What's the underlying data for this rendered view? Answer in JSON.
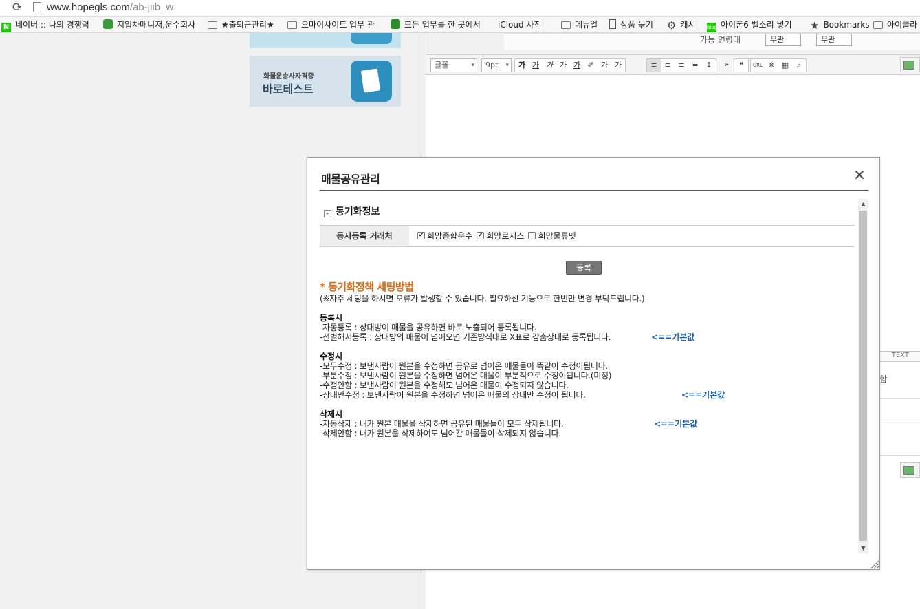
{
  "browser": {
    "url_host": "www.hopegls.com",
    "url_path": "/ab-jiib_w",
    "bookmarks": [
      {
        "icon": "naver-icon",
        "label": "네이버 :: 나의 경쟁력"
      },
      {
        "icon": "truck-icon",
        "label": "지입차매니저,운수회사"
      },
      {
        "icon": "folder-icon",
        "label": "★출퇴근관리★"
      },
      {
        "icon": "folder-icon",
        "label": "오마이사이트 업무 관"
      },
      {
        "icon": "evernote-icon",
        "label": "모든 업무를 한 곳에서"
      },
      {
        "icon": "apple-icon",
        "label": "iCloud 사진"
      },
      {
        "icon": "folder-icon",
        "label": "메뉴얼"
      },
      {
        "icon": "document-icon",
        "label": "상품 묶기"
      },
      {
        "icon": "gear-icon",
        "label": "캐시"
      },
      {
        "icon": "blog-icon",
        "label": "아이폰6 벨소리 넣기"
      },
      {
        "icon": "star-icon",
        "label": "Bookmarks"
      },
      {
        "icon": "folder-icon",
        "label": "아이클라"
      }
    ]
  },
  "background": {
    "banner_small": "화물운송사자격증",
    "banner_big": "바로테스트",
    "top_label": "가능 연령대",
    "top_select1": "무관",
    "top_select2": "무관",
    "font_select": "글꼴",
    "size_select": "9pt",
    "toolbar_buttons": [
      "가",
      "가",
      "가",
      "가",
      "가",
      "✐",
      "가",
      "가"
    ],
    "text_tab": "TEXT",
    "side_text": "함"
  },
  "modal": {
    "title": "매물공유관리",
    "section_title": "동기화정보",
    "row_label": "동시등록 거래처",
    "checkboxes": [
      {
        "label": "희망종합운수",
        "checked": true
      },
      {
        "label": "희망로지스",
        "checked": true
      },
      {
        "label": "희망물류넷",
        "checked": false
      }
    ],
    "register_button": "등록",
    "policy_title": "* 동기화정책 세팅방법",
    "policy_note": "(※자주 세팅을 하시면 오류가 발생할 수 있습니다. 필요하신 기능으로 한번만 변경 부탁드립니다.)",
    "register_head": "등록시",
    "register_lines": [
      "-자동등록 : 상대방이 매물을 공유하면 바로 노출되어 등록됩니다.",
      "-선별해서등록 : 상대방의 매물이 넘어오면 기존방식대로 X표로 감춤상태로 등록됩니다."
    ],
    "edit_head": "수정시",
    "edit_lines": [
      "-모두수정 : 보낸사람이 원본을 수정하면 공유로 넘어온 매물들이 똑같이 수정이됩니다.",
      "-부분수정 :  보낸사람이  원본을 수정하면 넘어온 매물이 부분적으로 수정이됩니다.(미정)",
      "-수정안함 :  보낸사람이  원본을 수정해도 넘어온 매물이 수정되지 않습니다.",
      "-상태만수정 :  보낸사람이  원본을 수정하면 넘어온 매물의 상태만 수정이 됩니다."
    ],
    "delete_head": "삭제시",
    "delete_lines": [
      "-자동삭제 : 내가 원본 매물을 삭제하면 공유된 매물들이 모두 삭제됩니다.",
      "-삭제안함 : 내가 원본을 삭제하여도 넘어간 매물들이 삭제되지 않습니다."
    ],
    "default_tag": "<==기본값"
  }
}
